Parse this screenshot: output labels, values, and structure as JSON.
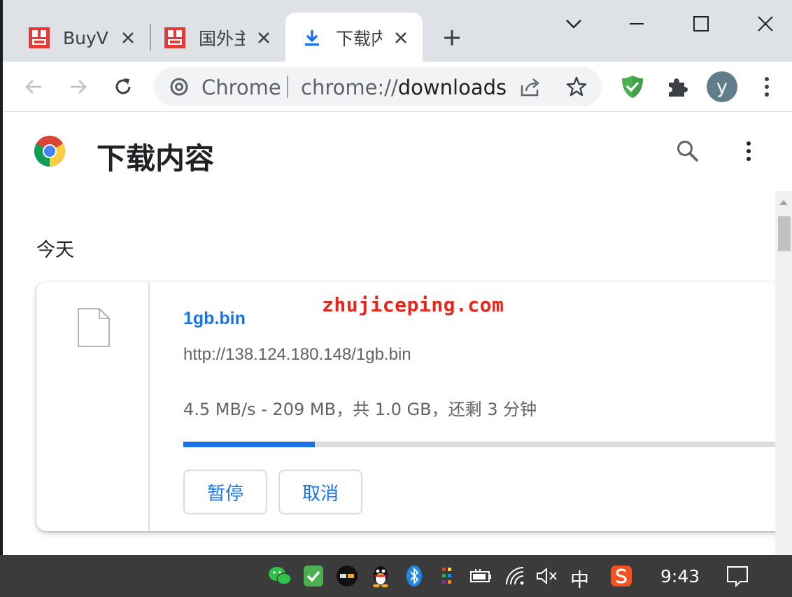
{
  "tabs": [
    {
      "title": "BuyVM",
      "icon": "site-favicon-red"
    },
    {
      "title": "国外主",
      "icon": "site-favicon-red"
    },
    {
      "title": "下载内",
      "icon": "download-icon",
      "active": true
    }
  ],
  "toolbar": {
    "omnibox_site": "Chrome",
    "omnibox_url_dim": "chrome://",
    "omnibox_url_path": "downloads",
    "avatar_letter": "y"
  },
  "page": {
    "title": "下载内容",
    "section": "今天"
  },
  "download": {
    "file_name": "1gb.bin",
    "watermark": "zhujiceping.com",
    "url": "http://138.124.180.148/1gb.bin",
    "status": "4.5 MB/s - 209 MB，共 1.0 GB，还剩 3 分钟",
    "progress": 0.209,
    "pause_label": "暂停",
    "cancel_label": "取消"
  },
  "taskbar": {
    "ime": "中",
    "clock": "9:43"
  },
  "colors": {
    "accent": "#1a73e8",
    "tabstrip": "#dee1e6",
    "adguard": "#4caf50",
    "taskbar": "#3b3b3b"
  }
}
